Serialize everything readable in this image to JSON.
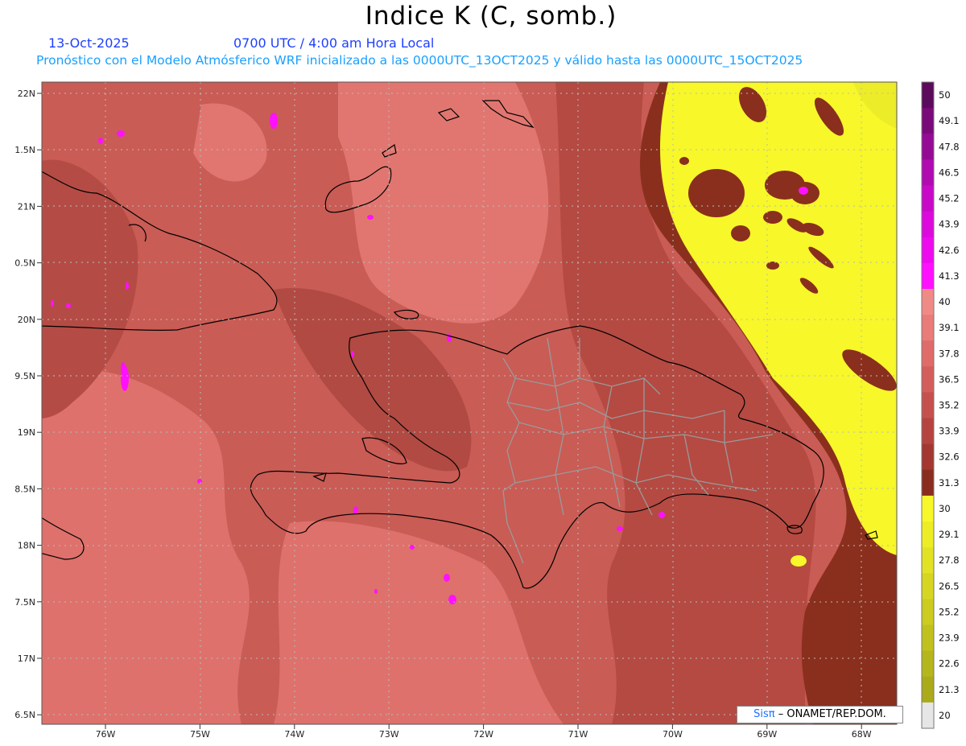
{
  "title": "Indice K (C, somb.)",
  "date": "13-Oct-2025",
  "time": "0700 UTC / 4:00 am Hora Local",
  "model_line": "Pronóstico con el Modelo Atmósferico WRF inicializado a las 0000UTC_13OCT2025 y válido hasta las  0000UTC_15OCT2025",
  "credit": {
    "logo": "Sisπ",
    "text": "– ONAMET/REP.DOM."
  },
  "lat_labels": [
    "22N",
    "1.5N",
    "21N",
    "0.5N",
    "20N",
    "9.5N",
    "19N",
    "8.5N",
    "18N",
    "7.5N",
    "17N",
    "6.5N"
  ],
  "lon_labels": [
    "76W",
    "75W",
    "74W",
    "73W",
    "72W",
    "71W",
    "70W",
    "69W",
    "68W"
  ],
  "colorbar": {
    "labels": [
      "50",
      "49.1",
      "47.8",
      "46.5",
      "45.2",
      "43.9",
      "42.6",
      "41.3",
      "40",
      "39.1",
      "37.8",
      "36.5",
      "35.2",
      "33.9",
      "32.6",
      "31.3",
      "30",
      "29.1",
      "27.8",
      "26.5",
      "25.2",
      "23.9",
      "22.6",
      "21.3",
      "20"
    ],
    "colors": [
      "#5c0a5c",
      "#7a0a7a",
      "#950a95",
      "#b00ab0",
      "#c80ac8",
      "#dc0adc",
      "#ee0aee",
      "#ff10ff",
      "#f08a86",
      "#e97c79",
      "#df6c69",
      "#d45e5b",
      "#c6504c",
      "#b54440",
      "#a2382f",
      "#8a2c1e",
      "#f7f72a",
      "#eded26",
      "#e2e224",
      "#d6d622",
      "#cbcb20",
      "#c0c01e",
      "#b5b51c",
      "#aaaa1a",
      "#e6e6e6"
    ]
  },
  "colors": {
    "base": "#c95c55",
    "light": "#e17670",
    "dark": "#a8433a",
    "darkest": "#8a2f1d",
    "yellow": "#f7f72a",
    "magenta": "#ff10ff"
  }
}
